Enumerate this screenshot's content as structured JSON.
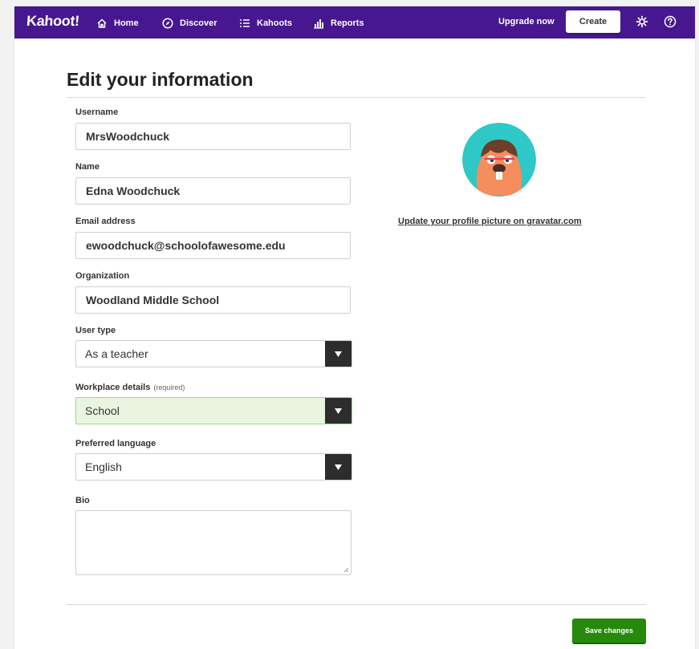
{
  "header": {
    "logo": "Kahoot!",
    "nav": [
      {
        "label": "Home",
        "icon": "home-icon"
      },
      {
        "label": "Discover",
        "icon": "compass-icon"
      },
      {
        "label": "Kahoots",
        "icon": "list-icon"
      },
      {
        "label": "Reports",
        "icon": "bar-chart-icon"
      }
    ],
    "upgrade_label": "Upgrade now",
    "create_label": "Create",
    "settings_icon": "gear-icon",
    "help_icon": "question-icon",
    "bg_color": "#46178f"
  },
  "form": {
    "title": "Edit your information",
    "username": {
      "label": "Username",
      "value": "MrsWoodchuck"
    },
    "name": {
      "label": "Name",
      "value": "Edna Woodchuck"
    },
    "email": {
      "label": "Email address",
      "value": "ewoodchuck@schoolofawesome.edu"
    },
    "organization": {
      "label": "Organization",
      "value": "Woodland Middle School"
    },
    "user_type": {
      "label": "User type",
      "value": "As a teacher"
    },
    "workplace": {
      "label": "Workplace details",
      "hint": "(required)",
      "value": "School"
    },
    "language": {
      "label": "Preferred language",
      "value": "English"
    },
    "bio": {
      "label": "Bio",
      "value": ""
    }
  },
  "profile": {
    "avatar_icon": "avatar-woodchuck",
    "link_text": "Update your profile picture on gravatar.com"
  },
  "footer": {
    "save_label": "Save changes",
    "save_color": "#26890c"
  }
}
